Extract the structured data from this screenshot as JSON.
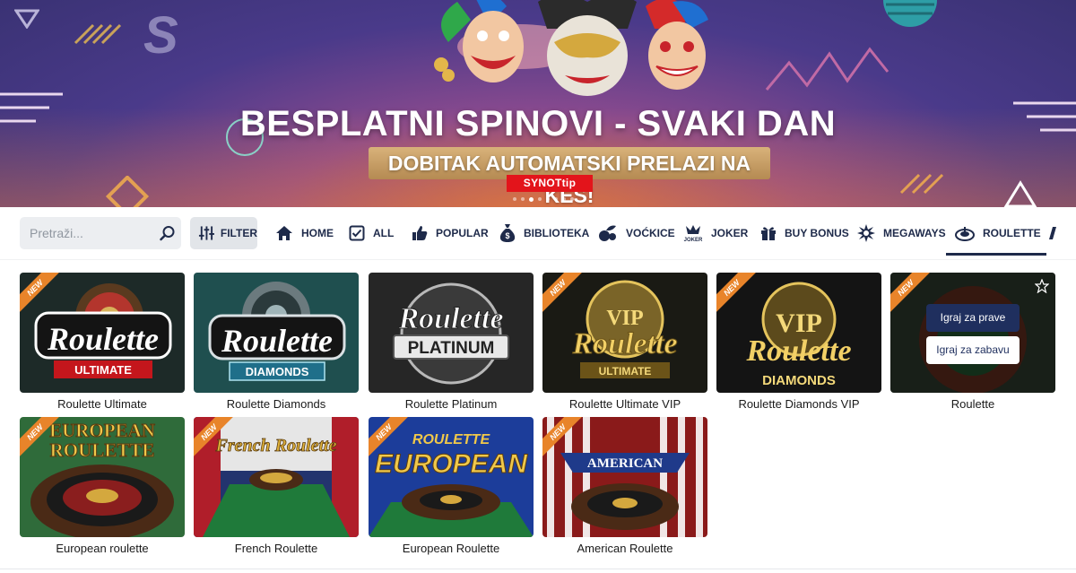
{
  "banner": {
    "title": "BESPLATNI SPINOVI - SVAKI DAN",
    "subtitle": "DOBITAK AUTOMATSKI PRELAZI NA KEŠ!",
    "logo": "SYNOTtip",
    "active_slide": 3,
    "slide_count": 8
  },
  "search": {
    "placeholder": "Pretraži..."
  },
  "filter": {
    "label": "FILTER"
  },
  "nav": [
    {
      "label": "HOME",
      "icon": "home-icon"
    },
    {
      "label": "ALL",
      "icon": "checkbox-icon"
    },
    {
      "label": "POPULAR",
      "icon": "thumbs-up-icon"
    },
    {
      "label": "BIBLIOTEKA",
      "icon": "money-bag-icon"
    },
    {
      "label": "VOĆKICE",
      "icon": "fruit-icon"
    },
    {
      "label": "JOKER",
      "icon": "joker-icon"
    },
    {
      "label": "BUY BONUS",
      "icon": "gift-icon"
    },
    {
      "label": "MEGAWAYS",
      "icon": "megaways-icon"
    },
    {
      "label": "ROULETTE",
      "icon": "roulette-icon",
      "active": true
    }
  ],
  "games": [
    {
      "title": "Roulette Ultimate",
      "art_text": "Roulette",
      "art_sub": "ULTIMATE",
      "new": true
    },
    {
      "title": "Roulette Diamonds",
      "art_text": "Roulette",
      "art_sub": "DIAMONDS",
      "new": false
    },
    {
      "title": "Roulette Platinum",
      "art_text": "Roulette",
      "art_sub": "PLATINUM",
      "new": false
    },
    {
      "title": "Roulette Ultimate VIP",
      "art_text": "Roulette",
      "art_sub": "ULTIMATE",
      "art_top": "VIP",
      "new": true
    },
    {
      "title": "Roulette Diamonds VIP",
      "art_text": "Roulette",
      "art_sub": "DIAMONDS",
      "art_top": "VIP",
      "new": true
    },
    {
      "title": "Roulette",
      "new": true,
      "hover": true
    },
    {
      "title": "European roulette",
      "art_text": "EUROPEAN",
      "art_sub": "ROULETTE",
      "new": true
    },
    {
      "title": "French Roulette",
      "art_text": "French Roulette",
      "new": true
    },
    {
      "title": "European Roulette",
      "art_text": "ROULETTE",
      "art_sub": "EUROPEAN",
      "new": true
    },
    {
      "title": "American Roulette",
      "art_text": "AMERICAN",
      "art_sub": "ROULETTE",
      "new": true
    }
  ],
  "badges": {
    "new_label": "NEW"
  },
  "hover_actions": {
    "play_real": "Igraj za prave",
    "play_fun": "Igraj za zabavu"
  },
  "colors": {
    "navy": "#1e2a4a",
    "ribbon": "#e8842a",
    "brand_red": "#e3141b"
  }
}
